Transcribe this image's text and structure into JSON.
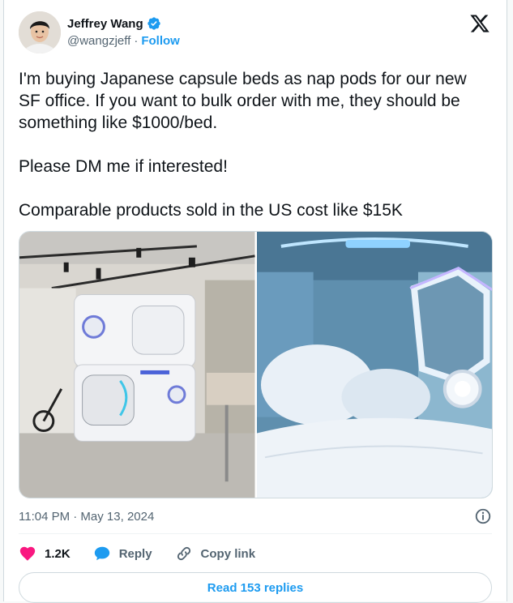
{
  "author": {
    "name": "Jeffrey Wang",
    "handle": "@wangzjeff",
    "separator": "·",
    "follow_label": "Follow",
    "brand_color": "#1d9bf0"
  },
  "tweet": {
    "paragraphs": [
      "I'm buying Japanese capsule beds as nap pods for our new SF office. If you want to bulk order with me, they should be something like $1000/bed.",
      "Please DM me if interested!",
      "Comparable products sold in the US cost like $15K"
    ],
    "timestamp": "11:04 PM · May 13, 2024"
  },
  "actions": {
    "like_count": "1.2K",
    "reply_label": "Reply",
    "copy_link_label": "Copy link"
  },
  "replies_button": "Read 153 replies",
  "icons": {
    "verified": "verified-badge-icon",
    "x_logo": "x-logo-icon",
    "info": "info-icon",
    "like": "heart-icon",
    "reply": "reply-bubble-icon",
    "copy_link": "link-icon"
  }
}
